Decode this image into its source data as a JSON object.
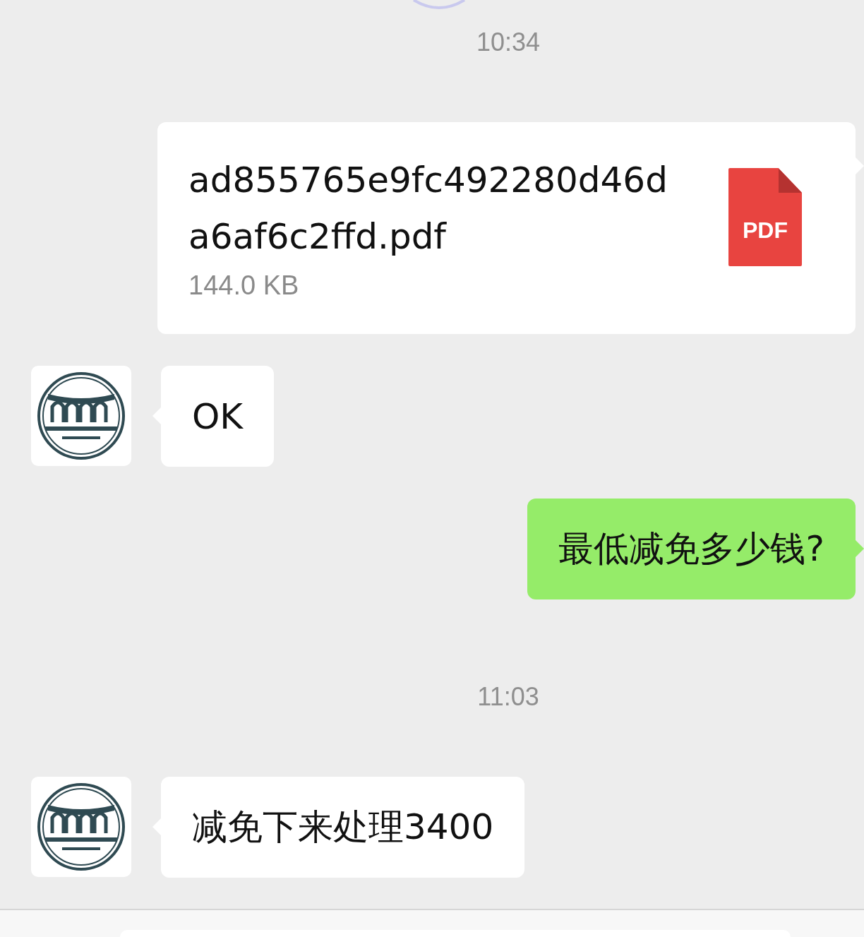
{
  "messages": [
    {
      "kind": "time",
      "text": "10:34"
    },
    {
      "kind": "file",
      "outgoing": true,
      "file_name": "ad855765e9fc492280d46da6af6c2ffd.pdf",
      "file_size": "144.0 KB",
      "file_type": "PDF"
    },
    {
      "kind": "text",
      "outgoing": false,
      "text": "OK"
    },
    {
      "kind": "text",
      "outgoing": true,
      "text": "最低减免多少钱?"
    },
    {
      "kind": "time",
      "text": "11:03"
    },
    {
      "kind": "text",
      "outgoing": false,
      "text": "减免下来处理3400"
    }
  ]
}
